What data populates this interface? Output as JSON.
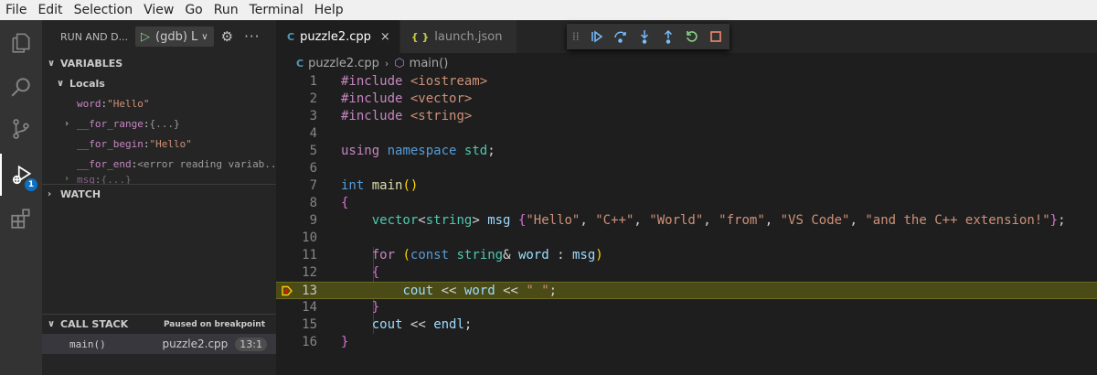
{
  "menu": [
    "File",
    "Edit",
    "Selection",
    "View",
    "Go",
    "Run",
    "Terminal",
    "Help"
  ],
  "activity_bar": {
    "items": [
      "explorer-icon",
      "search-icon",
      "source-control-icon",
      "run-debug-icon",
      "extensions-icon"
    ],
    "debug_badge": "1"
  },
  "sidebar": {
    "title": "RUN AND D...",
    "config_label": "(gdb) L",
    "variables": {
      "header": "VARIABLES",
      "locals_label": "Locals",
      "items": [
        {
          "name": "word",
          "sep": ": ",
          "value": "\"Hello\"",
          "expandable": false
        },
        {
          "name": "__for_range",
          "sep": ": ",
          "value": "{...}",
          "expandable": true
        },
        {
          "name": "__for_begin",
          "sep": ": ",
          "value": "\"Hello\"",
          "expandable": false
        },
        {
          "name": "__for_end",
          "sep": ": ",
          "value": "<error reading variab...",
          "expandable": false
        },
        {
          "name": "msg",
          "sep": ": ",
          "value": "{...}",
          "expandable": true
        }
      ]
    },
    "watch_header": "WATCH",
    "call_stack": {
      "header": "CALL STACK",
      "status": "Paused on breakpoint",
      "frames": [
        {
          "function": "main()",
          "file": "puzzle2.cpp",
          "position": "13:1"
        }
      ]
    }
  },
  "editor": {
    "tabs": [
      {
        "label": "puzzle2.cpp",
        "icon": "C",
        "active": true,
        "close": "×"
      },
      {
        "label": "launch.json",
        "icon": "{ }",
        "active": false
      }
    ],
    "debug_toolbar": [
      "continue-icon",
      "step-over-icon",
      "step-into-icon",
      "step-out-icon",
      "restart-icon",
      "stop-icon"
    ],
    "breadcrumb": {
      "file": "puzzle2.cpp",
      "symbol": "main()"
    },
    "current_line": 13,
    "line_numbers": [
      "1",
      "2",
      "3",
      "4",
      "5",
      "6",
      "7",
      "8",
      "9",
      "10",
      "11",
      "12",
      "13",
      "14",
      "15",
      "16"
    ],
    "code_lines": [
      "#include <iostream>",
      "#include <vector>",
      "#include <string>",
      "",
      "using namespace std;",
      "",
      "int main()",
      "{",
      "    vector<string> msg {\"Hello\", \"C++\", \"World\", \"from\", \"VS Code\", \"and the C++ extension!\"};",
      "",
      "    for (const string& word : msg)",
      "    {",
      "        cout << word << \" \";",
      "    }",
      "    cout << endl;",
      "}"
    ]
  },
  "colors": {
    "current_line": "#4b4b18",
    "breakpoint_arrow": "#ffcc00",
    "accent": "#0e70c0"
  }
}
